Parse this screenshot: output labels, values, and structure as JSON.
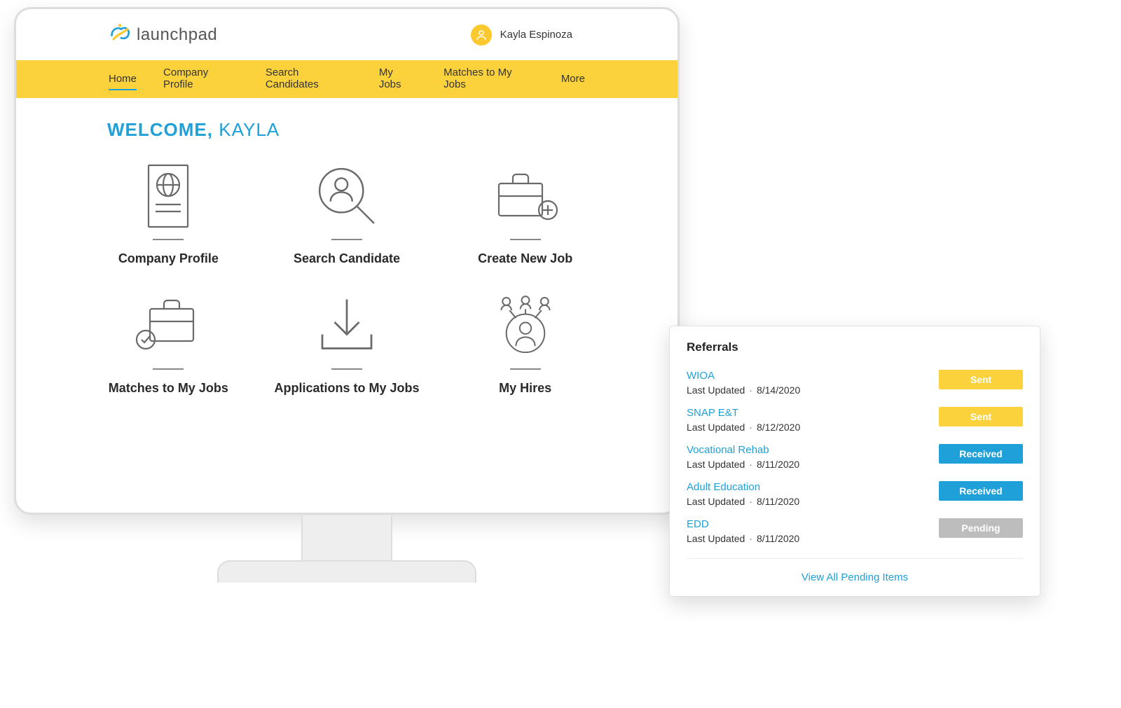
{
  "brand": {
    "name": "launchpad"
  },
  "user": {
    "name": "Kayla Espinoza"
  },
  "nav": {
    "items": [
      {
        "label": "Home",
        "active": true
      },
      {
        "label": "Company Profile",
        "active": false
      },
      {
        "label": "Search Candidates",
        "active": false
      },
      {
        "label": "My Jobs",
        "active": false
      },
      {
        "label": "Matches to My Jobs",
        "active": false
      },
      {
        "label": "More",
        "active": false
      }
    ]
  },
  "welcome": {
    "static": "WELCOME,",
    "name": "KAYLA"
  },
  "tiles": [
    {
      "label": "Company Profile",
      "icon": "document-globe-icon"
    },
    {
      "label": "Search Candidate",
      "icon": "search-person-icon"
    },
    {
      "label": "Create New Job",
      "icon": "briefcase-plus-icon"
    },
    {
      "label": "Matches to My Jobs",
      "icon": "briefcase-check-icon"
    },
    {
      "label": "Applications to My Jobs",
      "icon": "download-tray-icon"
    },
    {
      "label": "My Hires",
      "icon": "people-network-icon"
    }
  ],
  "referrals": {
    "title": "Referrals",
    "meta_label": "Last Updated",
    "view_all": "View All Pending Items",
    "items": [
      {
        "name": "WIOA",
        "date": "8/14/2020",
        "status": "Sent",
        "status_class": "sent"
      },
      {
        "name": "SNAP E&T",
        "date": "8/12/2020",
        "status": "Sent",
        "status_class": "sent"
      },
      {
        "name": "Vocational Rehab",
        "date": "8/11/2020",
        "status": "Received",
        "status_class": "received"
      },
      {
        "name": "Adult Education",
        "date": "8/11/2020",
        "status": "Received",
        "status_class": "received"
      },
      {
        "name": "EDD",
        "date": "8/11/2020",
        "status": "Pending",
        "status_class": "pending"
      }
    ]
  },
  "colors": {
    "accent_yellow": "#fcd23c",
    "accent_blue": "#1fa0d8",
    "grey": "#bdbdbd"
  }
}
